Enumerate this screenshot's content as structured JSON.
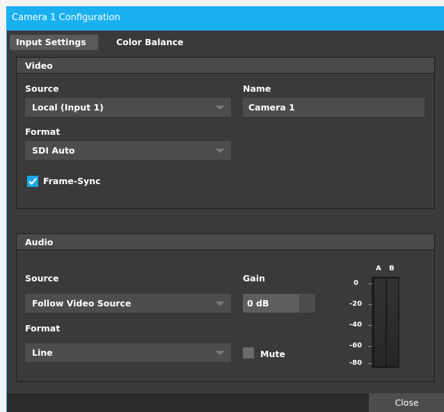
{
  "window": {
    "title": "Camera 1 Configuration",
    "tabs": [
      {
        "label": "Input Settings",
        "active": true
      },
      {
        "label": "Color Balance",
        "active": false
      }
    ]
  },
  "video": {
    "section_title": "Video",
    "source_label": "Source",
    "source_value": "Local (Input 1)",
    "name_label": "Name",
    "name_value": "Camera 1",
    "format_label": "Format",
    "format_value": "SDI Auto",
    "framesync_label": "Frame-Sync",
    "framesync_checked": true
  },
  "audio": {
    "section_title": "Audio",
    "source_label": "Source",
    "source_value": "Follow Video Source",
    "format_label": "Format",
    "format_value": "Line",
    "gain_label": "Gain",
    "gain_value": "0 dB",
    "gain_level": 0.78,
    "mute_label": "Mute",
    "mute_checked": false,
    "meter": {
      "channels": [
        "A",
        "B"
      ],
      "scale": [
        "0",
        "-20",
        "-40",
        "-60",
        "-80"
      ]
    }
  },
  "footer": {
    "close_label": "Close"
  },
  "colors": {
    "accent": "#1ab0f0",
    "background": "#3b3b3b",
    "field": "#4d4d4d"
  }
}
